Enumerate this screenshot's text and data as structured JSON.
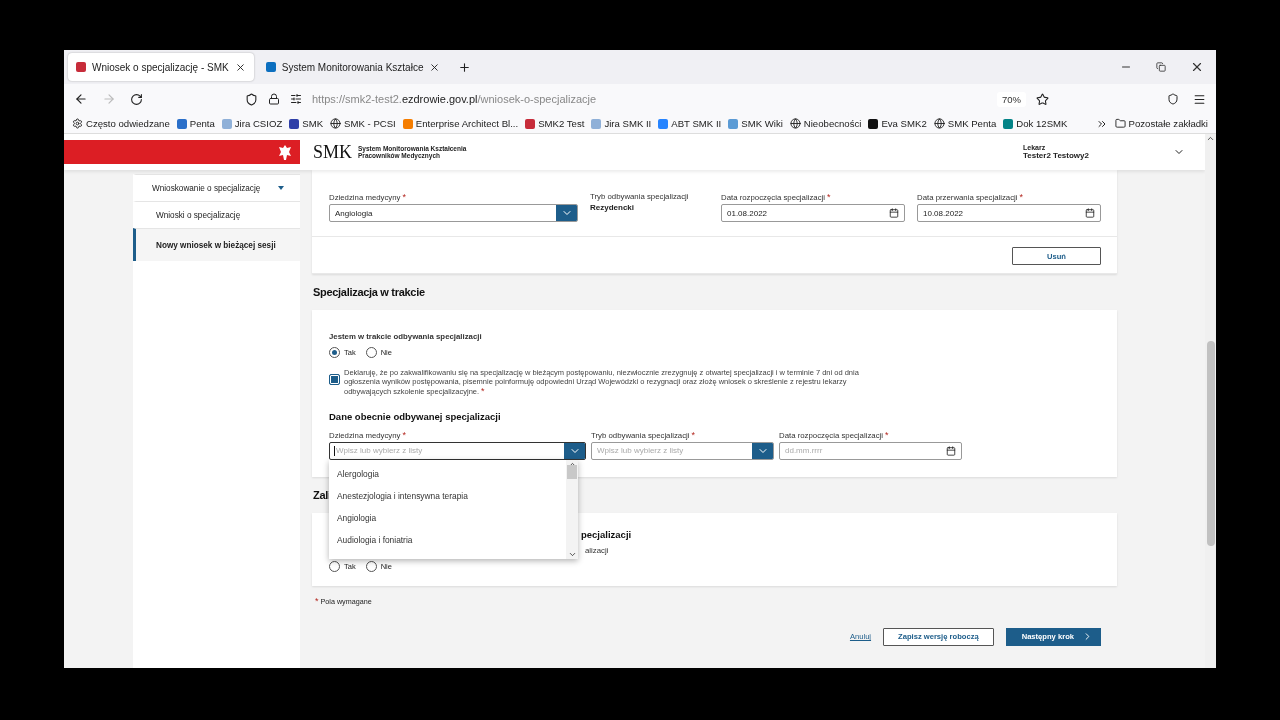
{
  "tabs": [
    {
      "title": "Wniosek o specjalizację - SMK",
      "kind": "emblem",
      "selected": true
    },
    {
      "title": "System Monitorowania Kształce",
      "kind": "edge",
      "selected": false
    }
  ],
  "address_bar": {
    "url_prefix": "https://smk2-test2.",
    "url_domain": "ezdrowie.gov.pl",
    "url_path": "/wniosek-o-specjalizacje",
    "zoom": "70%"
  },
  "bookmarks": [
    {
      "label": "Często odwiedzane",
      "kind": "gear"
    },
    {
      "label": "Penta",
      "kind": "penta"
    },
    {
      "label": "Jira CSIOZ",
      "kind": "cez"
    },
    {
      "label": "SMK",
      "kind": "smk"
    },
    {
      "label": "SMK - PCSI",
      "kind": "globe"
    },
    {
      "label": "Enterprise Architect Bl...",
      "kind": "blogger"
    },
    {
      "label": "SMK2 Test",
      "kind": "emblem"
    },
    {
      "label": "Jira SMK II",
      "kind": "cez"
    },
    {
      "label": "ABT SMK II",
      "kind": "confluence"
    },
    {
      "label": "SMK Wiki",
      "kind": "wiki"
    },
    {
      "label": "Nieobecności",
      "kind": "globe"
    },
    {
      "label": "Eva SMK2",
      "kind": "angular"
    },
    {
      "label": "SMK Penta",
      "kind": "globe"
    },
    {
      "label": "Dok 12SMK",
      "kind": "sharepoint"
    }
  ],
  "other_bookmarks": "Pozostałe zakładki",
  "header": {
    "logo": "SMK",
    "subtitle_lines": [
      "System Monitorowania Kształcenia",
      "Pracowników Medycznych"
    ],
    "role": "Lekarz",
    "user": "Tester2 Testowy2"
  },
  "sidebar": {
    "items": [
      {
        "label": "Wnioskowanie o specjalizację",
        "kind": "group",
        "expanded": true,
        "selected": false
      },
      {
        "label": "Wnioski o specjalizację",
        "kind": "link",
        "selected": false
      },
      {
        "label": "Nowy wniosek w bieżącej sesji",
        "kind": "link",
        "selected": true
      }
    ]
  },
  "previous_specialization": {
    "fields": [
      {
        "label": "Dziedzina medycyny",
        "mark": "*",
        "kind": "select",
        "value": "Angiologia"
      },
      {
        "label": "Tryb odbywania specjalizacji",
        "kind": "static",
        "value": "Rezydencki"
      },
      {
        "label": "Data rozpoczęcia specjalizacji",
        "mark": "*",
        "kind": "date",
        "value": "01.08.2022"
      },
      {
        "label": "Data przerwania specjalizacji",
        "mark": "*",
        "kind": "date",
        "value": "10.08.2022"
      }
    ],
    "remove_button": "Usuń"
  },
  "in_progress": {
    "heading": "Specjalizacja w trakcie",
    "question": "Jestem w trakcie odbywania specjalizacji",
    "options": [
      {
        "label": "Tak",
        "selected": true
      },
      {
        "label": "Nie",
        "selected": false
      }
    ],
    "declaration": {
      "text": "Deklaruję, że po zakwalifikowaniu się na specjalizację w bieżącym postępowaniu, niezwłocznie zrezygnuję z otwartej specjalizacji i w terminie 7 dni od dnia ogłoszenia wyników postępowania, pisemnie poinformuję odpowiedni Urząd Wojewódzki o rezygnacji oraz złożę wniosek o skreślenie z rejestru lekarzy odbywających szkolenie specjalizacyjne.",
      "mark": "*",
      "checked": true
    },
    "subheading": "Dane obecnie odbywanej specjalizacji",
    "fields": [
      {
        "label": "Dziedzina medycyny",
        "mark": "*",
        "kind": "select",
        "placeholder": "Wpisz lub wybierz z listy",
        "focused": true
      },
      {
        "label": "Tryb odbywania specjalizacji",
        "mark": "*",
        "kind": "select",
        "placeholder": "Wpisz lub wybierz z listy"
      },
      {
        "label": "Data rozpoczęcia specjalizacji",
        "mark": "*",
        "kind": "date",
        "placeholder": "dd.mm.rrrr"
      }
    ],
    "dropdown": {
      "options": [
        "Alergologia",
        "Anestezjologia i intensywna terapia",
        "Angiologia",
        "Audiologia i foniatria"
      ]
    }
  },
  "third_section": {
    "heading": "Zali",
    "card_heading": "pecjalizacji",
    "question": "alizacji",
    "options": [
      {
        "label": "Tak",
        "selected": false
      },
      {
        "label": "Nie",
        "selected": false
      }
    ]
  },
  "required_note": {
    "mark": "*",
    "text": "Pola wymagane"
  },
  "actions": {
    "cancel": "Anuluj",
    "save_draft": "Zapisz wersję roboczą",
    "next": "Następny krok"
  }
}
